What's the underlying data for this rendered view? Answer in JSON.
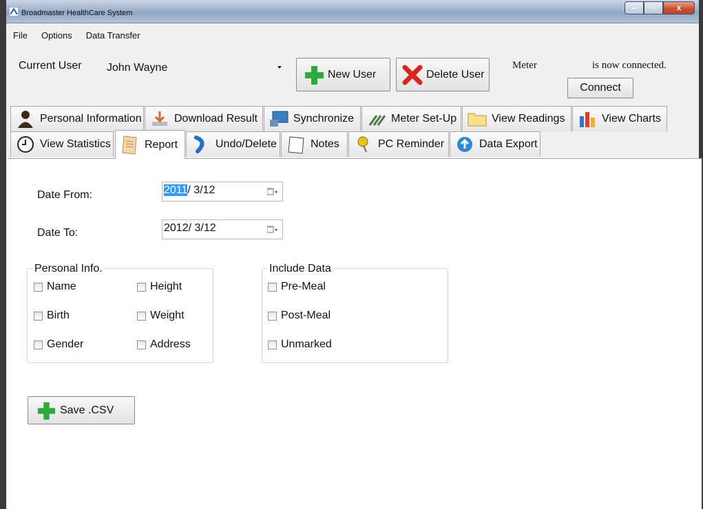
{
  "window": {
    "title": "Broadmaster HealthCare System"
  },
  "menu": [
    "File",
    "Options",
    "Data Transfer"
  ],
  "user": {
    "label": "Current User",
    "value": "John Wayne",
    "new_button": "New User",
    "delete_button": "Delete User"
  },
  "meter": {
    "label": "Meter",
    "status": "is now connected.",
    "connect_button": "Connect"
  },
  "tabs_row1": [
    {
      "label": "Personal Information",
      "icon": "person-icon"
    },
    {
      "label": "Download Result",
      "icon": "download-icon"
    },
    {
      "label": "Synchronize",
      "icon": "monitor-icon"
    },
    {
      "label": "Meter Set-Up",
      "icon": "wrench-icon"
    },
    {
      "label": "View Readings",
      "icon": "folder-icon"
    },
    {
      "label": "View Charts",
      "icon": "bar-chart-icon"
    }
  ],
  "tabs_row2": [
    {
      "label": "View Statistics",
      "icon": "clock-icon"
    },
    {
      "label": "Report",
      "icon": "report-icon",
      "active": true
    },
    {
      "label": "Undo/Delete",
      "icon": "undo-icon"
    },
    {
      "label": "Notes",
      "icon": "notes-icon"
    },
    {
      "label": "PC Reminder",
      "icon": "pin-icon"
    },
    {
      "label": "Data Export",
      "icon": "export-icon"
    }
  ],
  "report": {
    "date_from_label": "Date From:",
    "date_from_year": "2011",
    "date_from_rest": "/  3/12",
    "date_to_label": "Date To:",
    "date_to_value": "2012/  3/12",
    "personal_info": {
      "title": "Personal Info.",
      "items": [
        "Name",
        "Height",
        "Birth",
        "Weight",
        "Gender",
        "Address"
      ]
    },
    "include_data": {
      "title": "Include Data",
      "items": [
        "Pre-Meal",
        "Post-Meal",
        "Unmarked"
      ]
    },
    "save_button": "Save .CSV"
  },
  "colors": {
    "add_green": "#2eaa3c",
    "delete_red": "#d9261c",
    "selection_blue": "#3399ff"
  }
}
